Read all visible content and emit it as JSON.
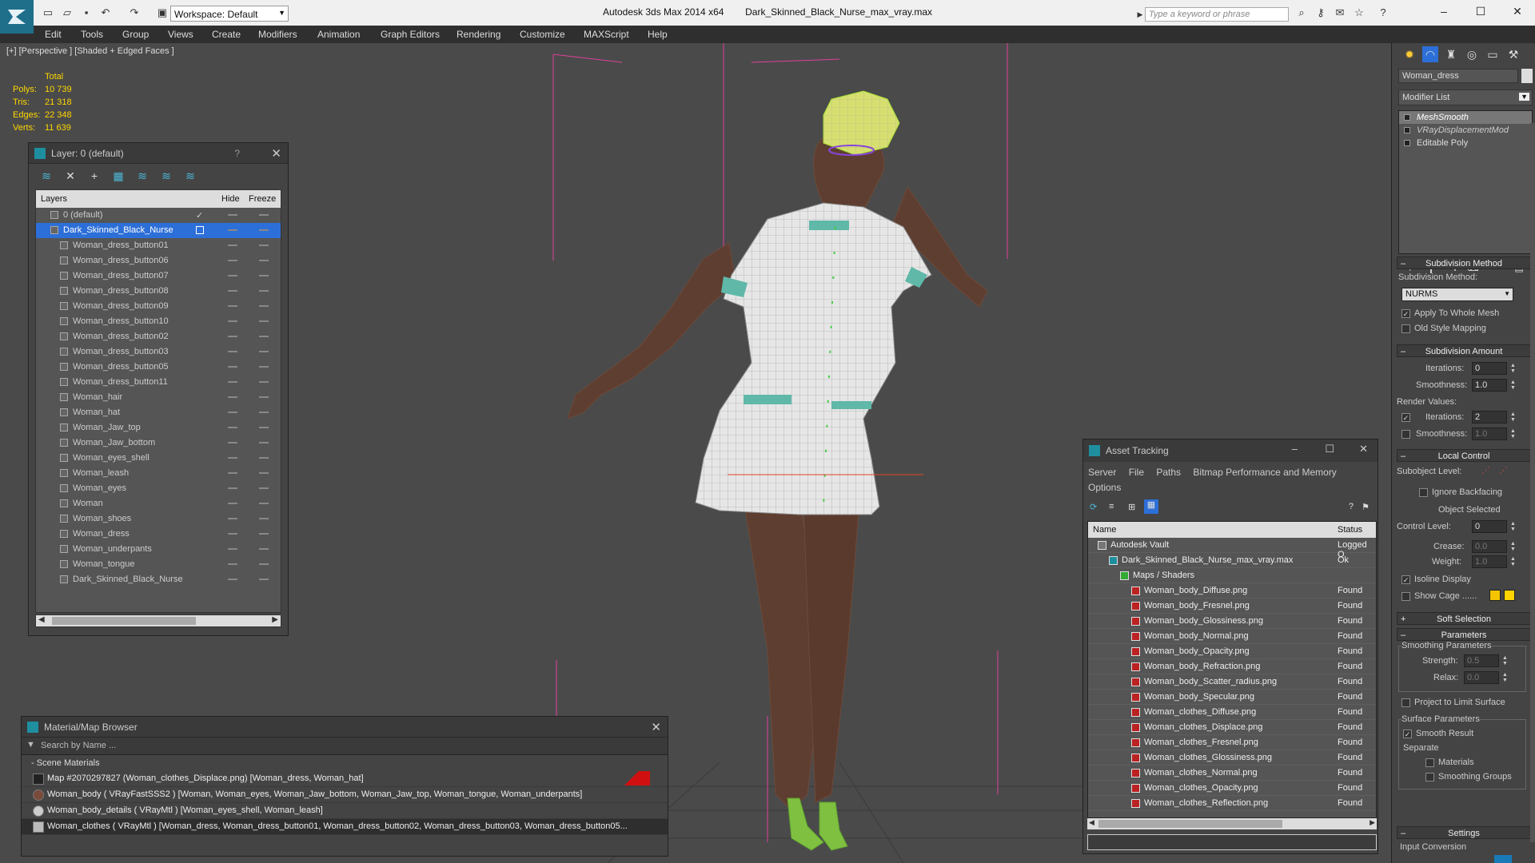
{
  "title_bar": {
    "workspace": "Workspace: Default",
    "app_title": "Autodesk 3ds Max  2014 x64",
    "file_name": "Dark_Skinned_Black_Nurse_max_vray.max",
    "search_placeholder": "Type a keyword or phrase"
  },
  "menu": [
    "Edit",
    "Tools",
    "Group",
    "Views",
    "Create",
    "Modifiers",
    "Animation",
    "Graph Editors",
    "Rendering",
    "Customize",
    "MAXScript",
    "Help"
  ],
  "viewport": {
    "label": "[+] [Perspective ] [Shaded + Edged Faces ]",
    "stats": {
      "header": "Total",
      "rows": [
        {
          "label": "Polys:",
          "value": "10 739"
        },
        {
          "label": "Tris:",
          "value": "21 318"
        },
        {
          "label": "Edges:",
          "value": "22 348"
        },
        {
          "label": "Verts:",
          "value": "11 639"
        }
      ]
    }
  },
  "layer_panel": {
    "title": "Layer: 0 (default)",
    "help": "?",
    "columns": {
      "layers": "Layers",
      "hide": "Hide",
      "freeze": "Freeze"
    },
    "rows": [
      {
        "name": "0 (default)",
        "check": "✓"
      },
      {
        "name": "Dark_Skinned_Black_Nurse"
      },
      {
        "name": "Woman_dress_button01"
      },
      {
        "name": "Woman_dress_button06"
      },
      {
        "name": "Woman_dress_button07"
      },
      {
        "name": "Woman_dress_button08"
      },
      {
        "name": "Woman_dress_button09"
      },
      {
        "name": "Woman_dress_button10"
      },
      {
        "name": "Woman_dress_button02"
      },
      {
        "name": "Woman_dress_button03"
      },
      {
        "name": "Woman_dress_button05"
      },
      {
        "name": "Woman_dress_button11"
      },
      {
        "name": "Woman_hair"
      },
      {
        "name": "Woman_hat"
      },
      {
        "name": "Woman_Jaw_top"
      },
      {
        "name": "Woman_Jaw_bottom"
      },
      {
        "name": "Woman_eyes_shell"
      },
      {
        "name": "Woman_leash"
      },
      {
        "name": "Woman_eyes"
      },
      {
        "name": "Woman"
      },
      {
        "name": "Woman_shoes"
      },
      {
        "name": "Woman_dress"
      },
      {
        "name": "Woman_underpants"
      },
      {
        "name": "Woman_tongue"
      },
      {
        "name": "Dark_Skinned_Black_Nurse"
      }
    ]
  },
  "material_browser": {
    "title": "Material/Map Browser",
    "search_placeholder": "Search by Name ...",
    "section": "- Scene Materials",
    "rows": [
      "Map #2070297827 (Woman_clothes_Displace.png)  [Woman_dress, Woman_hat]",
      "Woman_body  ( VRayFastSSS2 )  [Woman, Woman_eyes, Woman_Jaw_bottom, Woman_Jaw_top, Woman_tongue, Woman_underpants]",
      "Woman_body_details  ( VRayMtl )  [Woman_eyes_shell, Woman_leash]",
      "Woman_clothes  ( VRayMtl )  [Woman_dress, Woman_dress_button01, Woman_dress_button02, Woman_dress_button03, Woman_dress_button05..."
    ]
  },
  "asset_tracking": {
    "title": "Asset Tracking",
    "menu": [
      "Server",
      "File",
      "Paths",
      "Bitmap Performance and Memory",
      "Options"
    ],
    "columns": {
      "name": "Name",
      "status": "Status"
    },
    "rows": [
      {
        "name": "Autodesk Vault",
        "status": "Logged O",
        "indent": 0
      },
      {
        "name": "Dark_Skinned_Black_Nurse_max_vray.max",
        "status": "Ok",
        "indent": 1
      },
      {
        "name": "Maps / Shaders",
        "status": "",
        "indent": 2
      },
      {
        "name": "Woman_body_Diffuse.png",
        "status": "Found",
        "indent": 3
      },
      {
        "name": "Woman_body_Fresnel.png",
        "status": "Found",
        "indent": 3
      },
      {
        "name": "Woman_body_Glossiness.png",
        "status": "Found",
        "indent": 3
      },
      {
        "name": "Woman_body_Normal.png",
        "status": "Found",
        "indent": 3
      },
      {
        "name": "Woman_body_Opacity.png",
        "status": "Found",
        "indent": 3
      },
      {
        "name": "Woman_body_Refraction.png",
        "status": "Found",
        "indent": 3
      },
      {
        "name": "Woman_body_Scatter_radius.png",
        "status": "Found",
        "indent": 3
      },
      {
        "name": "Woman_body_Specular.png",
        "status": "Found",
        "indent": 3
      },
      {
        "name": "Woman_clothes_Diffuse.png",
        "status": "Found",
        "indent": 3
      },
      {
        "name": "Woman_clothes_Displace.png",
        "status": "Found",
        "indent": 3
      },
      {
        "name": "Woman_clothes_Fresnel.png",
        "status": "Found",
        "indent": 3
      },
      {
        "name": "Woman_clothes_Glossiness.png",
        "status": "Found",
        "indent": 3
      },
      {
        "name": "Woman_clothes_Normal.png",
        "status": "Found",
        "indent": 3
      },
      {
        "name": "Woman_clothes_Opacity.png",
        "status": "Found",
        "indent": 3
      },
      {
        "name": "Woman_clothes_Reflection.png",
        "status": "Found",
        "indent": 3
      }
    ]
  },
  "command_panel": {
    "object_name": "Woman_dress",
    "modifier_list": "Modifier List",
    "stack": [
      "MeshSmooth",
      "VRayDisplacementMod",
      "Editable Poly"
    ],
    "subdivision_method": {
      "header": "Subdivision Method",
      "label": "Subdivision Method:",
      "value": "NURMS",
      "apply_whole_mesh": "Apply To Whole Mesh",
      "old_style": "Old Style Mapping"
    },
    "subdivision_amount": {
      "header": "Subdivision Amount",
      "iterations_label": "Iterations:",
      "iterations": "0",
      "smoothness_label": "Smoothness:",
      "smoothness": "1.0",
      "render_values": "Render Values:",
      "render_iterations": "2",
      "render_smoothness": "1.0"
    },
    "local_control": {
      "header": "Local Control",
      "subobject_level": "Subobject Level:",
      "ignore_backfacing": "Ignore Backfacing",
      "object_selected": "Object Selected",
      "control_level_label": "Control Level:",
      "control_level": "0",
      "crease_label": "Crease:",
      "crease": "0.0",
      "weight_label": "Weight:",
      "weight": "1.0",
      "isoline": "Isoline Display",
      "show_cage": "Show Cage ......"
    },
    "soft_selection": "Soft Selection",
    "parameters": {
      "header": "Parameters",
      "smoothing_params": "Smoothing Parameters",
      "strength_label": "Strength:",
      "strength": "0.5",
      "relax_label": "Relax:",
      "relax": "0.0",
      "project": "Project to Limit Surface",
      "surface_params": "Surface Parameters",
      "smooth_result": "Smooth Result",
      "separate": "Separate",
      "materials": "Materials",
      "smoothing_groups": "Smoothing Groups"
    },
    "settings": "Settings",
    "input_conversion": "Input Conversion",
    "cage_colors": [
      "#f5c400",
      "#ffd400"
    ]
  }
}
